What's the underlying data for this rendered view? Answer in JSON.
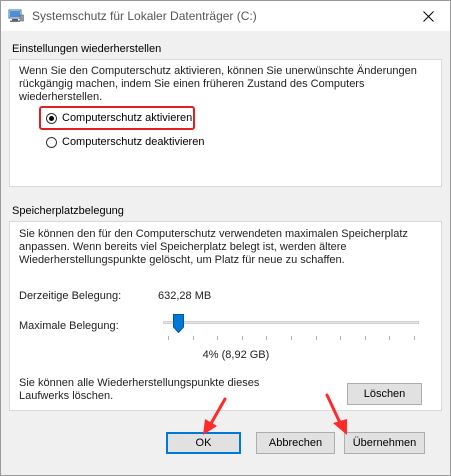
{
  "window": {
    "title": "Systemschutz für Lokaler Datenträger (C:)"
  },
  "restore": {
    "section_title": "Einstellungen wiederherstellen",
    "description_lines": [
      "Wenn Sie den Computerschutz aktivieren, können Sie unerwünschte Änderungen",
      "rückgängig machen, indem Sie einen früheren Zustand des Computers",
      "wiederherstellen."
    ],
    "options": [
      {
        "label": "Computerschutz aktivieren",
        "selected": true
      },
      {
        "label": "Computerschutz deaktivieren",
        "selected": false
      }
    ]
  },
  "storage": {
    "section_title": "Speicherplatzbelegung",
    "description_lines": [
      "Sie können den für den Computerschutz verwendeten maximalen Speicherplatz",
      "anpassen. Wenn bereits viel Speicherplatz belegt ist, werden ältere",
      "Wiederherstellungspunkte gelöscht, um Platz für neue zu schaffen."
    ],
    "current_label": "Derzeitige Belegung:",
    "current_value": "632,28 MB",
    "max_label": "Maximale Belegung:",
    "max_percent": 4,
    "max_display": "4% (8,92 GB)",
    "delete_text_lines": [
      "Sie können alle Wiederherstellungspunkte dieses",
      "Laufwerks löschen."
    ],
    "delete_button": "Löschen"
  },
  "buttons": {
    "ok": "OK",
    "cancel": "Abbrechen",
    "apply": "Übernehmen"
  },
  "colors": {
    "highlight": "#e02020",
    "arrow": "#ff2a2a",
    "accent": "#0078d7"
  }
}
